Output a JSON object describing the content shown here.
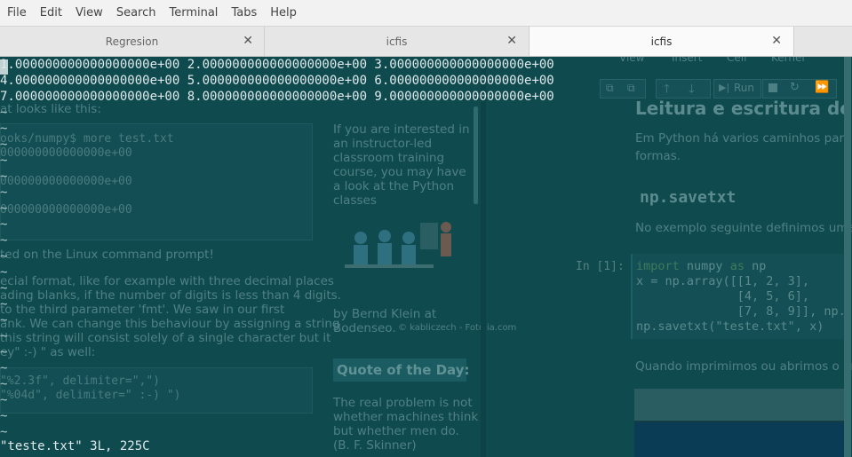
{
  "menubar": {
    "items": [
      "File",
      "Edit",
      "View",
      "Search",
      "Terminal",
      "Tabs",
      "Help"
    ]
  },
  "tabs": [
    {
      "title": "Regresion",
      "active": false
    },
    {
      "title": "icfis",
      "active": false
    },
    {
      "title": "icfis",
      "active": true
    }
  ],
  "vim": {
    "lines": [
      "1.000000000000000000e+00 2.000000000000000000e+00 3.000000000000000000e+00",
      "4.000000000000000000e+00 5.000000000000000000e+00 6.000000000000000000e+00",
      "7.000000000000000000e+00 8.000000000000000000e+00 9.000000000000000000e+00"
    ],
    "tilde": "~",
    "status": "\"teste.txt\" 3L, 225C"
  },
  "background_page": {
    "left_lines": [
      "at looks like this:",
      "ooks/numpy$ more test.txt",
      "000000000000000e+00",
      "000000000000000e+00",
      "000000000000000e+00",
      "ted on the Linux command prompt!",
      "ecial format, like for example with three decimal places",
      "ading blanks, if the number of digits is less than 4 digits.",
      "to the third parameter 'fmt'. We saw in our first",
      "ank. We can change this behaviour by assigning a string",
      "this string will consist solely of a single character but it",
      "ey\" :-) \" as well:",
      "\"%2.3f\", delimiter=\",\")",
      "\"%04d\", delimiter=\" :-) \")"
    ],
    "sidebar": {
      "course_text": [
        "If you are interested in",
        "an instructor-led",
        "classroom training",
        "course, you may have",
        "a look at the Python",
        "classes"
      ],
      "credit": [
        "by Bernd Klein at",
        "Bodenseo."
      ],
      "image_credit": "© kabliczech - Fotolia.com",
      "quote_title": "Quote of the Day:",
      "quote": [
        "The real problem is not",
        "whether machines think",
        "but whether men do.",
        "(B. F. Skinner)"
      ]
    },
    "notebook": {
      "menu": [
        "View",
        "Insert",
        "Cell",
        "Kernel"
      ],
      "run_label": "Run",
      "heading": "Leitura e escritura de d",
      "intro": [
        "Em Python há varios caminhos para l",
        "formas."
      ],
      "subheading": "np.savetxt",
      "example_text": "No exemplo seguinte definimos uma",
      "prompt": "In [1]:",
      "code": [
        "import numpy as np",
        "x = np.array([[1, 2, 3],",
        "              [4, 5, 6],",
        "              [7, 8, 9]], np.",
        "np.savetxt(\"teste.txt\", x)"
      ],
      "after_text": "Quando imprimimos ou abrimos o arq"
    }
  }
}
